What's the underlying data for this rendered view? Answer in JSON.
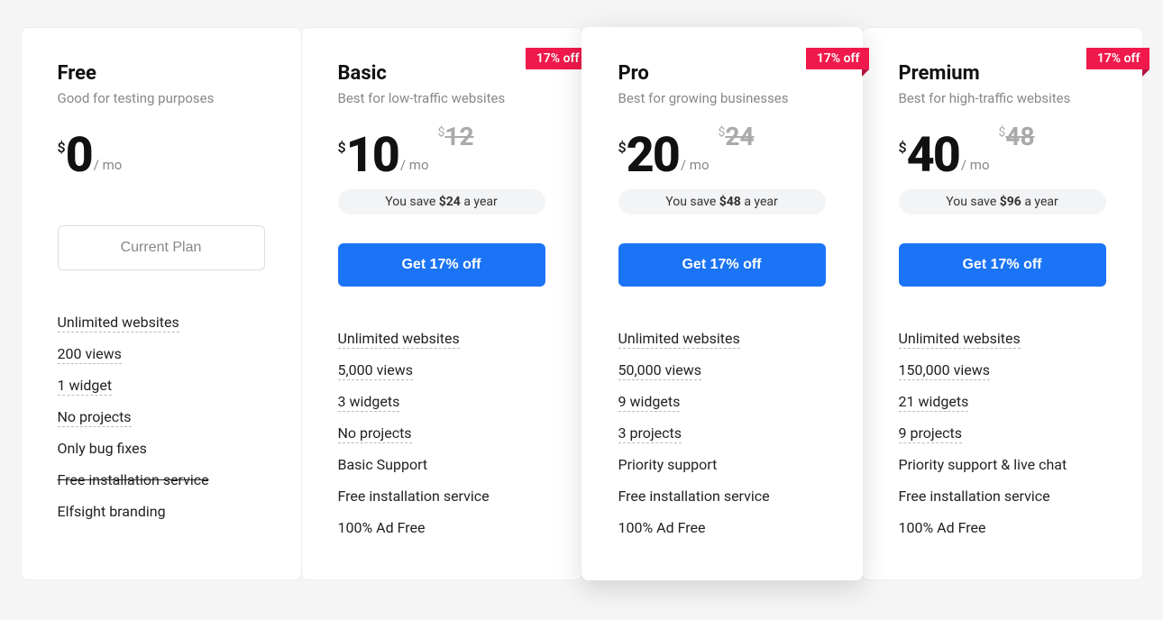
{
  "currency_symbol": "$",
  "per_unit": "/ mo",
  "ribbon_text": "17% off",
  "save_prefix": "You save ",
  "save_suffix": " a year",
  "plans": [
    {
      "title": "Free",
      "subtitle": "Good for testing purposes",
      "price": "0",
      "old_price": null,
      "save_amount": null,
      "cta_label": "Current Plan",
      "cta_style": "current",
      "ribbon": false,
      "highlighted": false,
      "features": [
        {
          "text": "Unlimited websites",
          "underline": true,
          "strike": false
        },
        {
          "text": "200 views",
          "underline": true,
          "strike": false
        },
        {
          "text": "1 widget",
          "underline": true,
          "strike": false
        },
        {
          "text": "No projects",
          "underline": true,
          "strike": false
        },
        {
          "text": "Only bug fixes",
          "underline": false,
          "strike": false
        },
        {
          "text": "Free installation service",
          "underline": false,
          "strike": true
        },
        {
          "text": "Elfsight branding",
          "underline": false,
          "strike": false
        }
      ]
    },
    {
      "title": "Basic",
      "subtitle": "Best for low-traffic websites",
      "price": "10",
      "old_price": "12",
      "save_amount": "$24",
      "cta_label": "Get 17% off",
      "cta_style": "primary",
      "ribbon": true,
      "highlighted": false,
      "features": [
        {
          "text": "Unlimited websites",
          "underline": true,
          "strike": false
        },
        {
          "text": "5,000 views",
          "underline": true,
          "strike": false
        },
        {
          "text": "3 widgets",
          "underline": true,
          "strike": false
        },
        {
          "text": "No projects",
          "underline": true,
          "strike": false
        },
        {
          "text": "Basic Support",
          "underline": false,
          "strike": false
        },
        {
          "text": "Free installation service",
          "underline": false,
          "strike": false
        },
        {
          "text": "100% Ad Free",
          "underline": false,
          "strike": false
        }
      ]
    },
    {
      "title": "Pro",
      "subtitle": "Best for growing businesses",
      "price": "20",
      "old_price": "24",
      "save_amount": "$48",
      "cta_label": "Get 17% off",
      "cta_style": "primary",
      "ribbon": true,
      "highlighted": true,
      "features": [
        {
          "text": "Unlimited websites",
          "underline": true,
          "strike": false
        },
        {
          "text": "50,000 views",
          "underline": true,
          "strike": false
        },
        {
          "text": "9 widgets",
          "underline": true,
          "strike": false
        },
        {
          "text": "3 projects",
          "underline": true,
          "strike": false
        },
        {
          "text": "Priority support",
          "underline": false,
          "strike": false
        },
        {
          "text": "Free installation service",
          "underline": false,
          "strike": false
        },
        {
          "text": "100% Ad Free",
          "underline": false,
          "strike": false
        }
      ]
    },
    {
      "title": "Premium",
      "subtitle": "Best for high-traffic websites",
      "price": "40",
      "old_price": "48",
      "save_amount": "$96",
      "cta_label": "Get 17% off",
      "cta_style": "primary",
      "ribbon": true,
      "highlighted": false,
      "features": [
        {
          "text": "Unlimited websites",
          "underline": true,
          "strike": false
        },
        {
          "text": "150,000 views",
          "underline": true,
          "strike": false
        },
        {
          "text": "21 widgets",
          "underline": true,
          "strike": false
        },
        {
          "text": "9 projects",
          "underline": true,
          "strike": false
        },
        {
          "text": "Priority support & live chat",
          "underline": false,
          "strike": false
        },
        {
          "text": "Free installation service",
          "underline": false,
          "strike": false
        },
        {
          "text": "100% Ad Free",
          "underline": false,
          "strike": false
        }
      ]
    }
  ]
}
